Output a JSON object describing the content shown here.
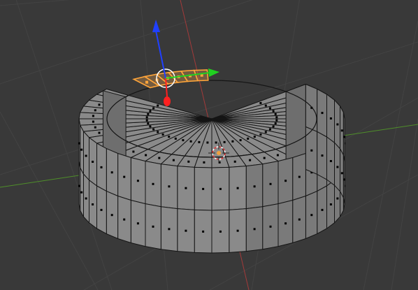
{
  "app": {
    "name": "3D Viewport",
    "mode": "edit-mode",
    "selection": "face"
  },
  "colors": {
    "background": "#393939",
    "grid_line": "#434343",
    "axis_x": "#a33a3a",
    "axis_y": "#4f8f2a",
    "mesh_face": "#8a8a8a",
    "mesh_face_dark": "#6e6e6e",
    "mesh_edge": "#151515",
    "face_dot": "#000000",
    "selected_face": "#e39a4a",
    "selected_edge": "#ffa53a",
    "gizmo_x": "#ff2020",
    "gizmo_y": "#20d020",
    "gizmo_z": "#2040ff",
    "cursor_red": "#e03030",
    "origin_dot": "#f0a040"
  },
  "gizmo": {
    "type": "translate",
    "axes": [
      "x-arrow",
      "y-arrow",
      "z-arrow"
    ]
  },
  "cursor_3d": {
    "icon": "3d-cursor-icon"
  },
  "mesh": {
    "name": "cylinder-ring",
    "segments": 48,
    "selected_faces": 6
  }
}
